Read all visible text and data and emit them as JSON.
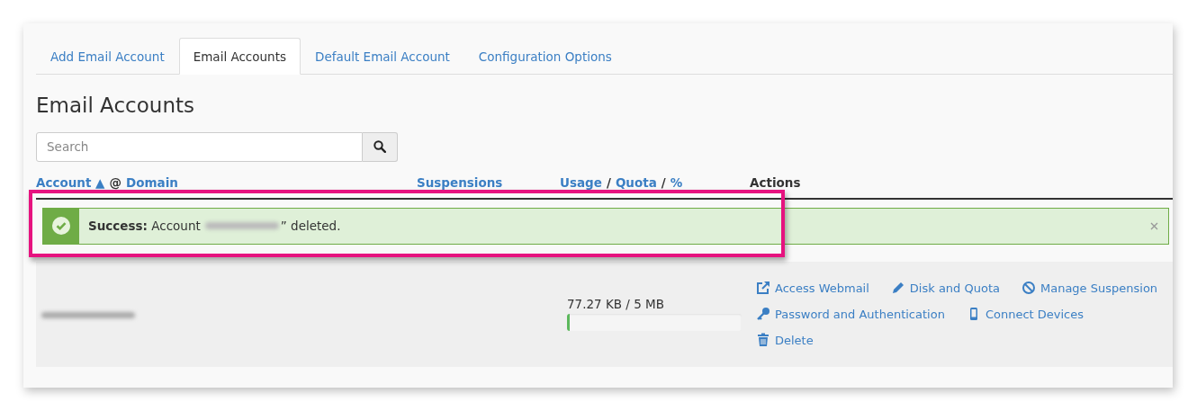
{
  "tabs": [
    {
      "label": "Add Email Account",
      "selected": false
    },
    {
      "label": "Email Accounts",
      "selected": true
    },
    {
      "label": "Default Email Account",
      "selected": false
    },
    {
      "label": "Configuration Options",
      "selected": false
    }
  ],
  "heading": "Email Accounts",
  "search": {
    "placeholder": "Search"
  },
  "table": {
    "columns": [
      {
        "parts": [
          {
            "text": "Account ▲",
            "kind": "link"
          },
          {
            "text": "@",
            "kind": "text"
          },
          {
            "text": "Domain",
            "kind": "link"
          }
        ]
      },
      {
        "parts": [
          {
            "text": "Suspensions",
            "kind": "link"
          }
        ]
      },
      {
        "parts": [
          {
            "text": "Usage",
            "kind": "link"
          },
          {
            "text": "/",
            "kind": "text"
          },
          {
            "text": "Quota",
            "kind": "link"
          },
          {
            "text": "/",
            "kind": "text"
          },
          {
            "text": "%",
            "kind": "link"
          }
        ]
      },
      {
        "parts": [
          {
            "text": "Actions",
            "kind": "text"
          }
        ]
      }
    ],
    "alert": {
      "label": "Success:",
      "before": "Account",
      "after": "” deleted."
    },
    "rows": [
      {
        "usage": "77.27 KB / 5 MB",
        "level": 0.01,
        "action_lines": [
          [
            {
              "label": "Access Webmail",
              "kind": "external"
            },
            {
              "label": "Disk and Quota",
              "kind": "pencil"
            },
            {
              "label": "Manage Suspension",
              "kind": "ban"
            }
          ],
          [
            {
              "label": "Password and Authentication",
              "kind": "key"
            },
            {
              "label": "Connect Devices",
              "kind": "phone"
            }
          ],
          [
            {
              "label": "Delete",
              "kind": "trash"
            }
          ]
        ]
      }
    ]
  }
}
